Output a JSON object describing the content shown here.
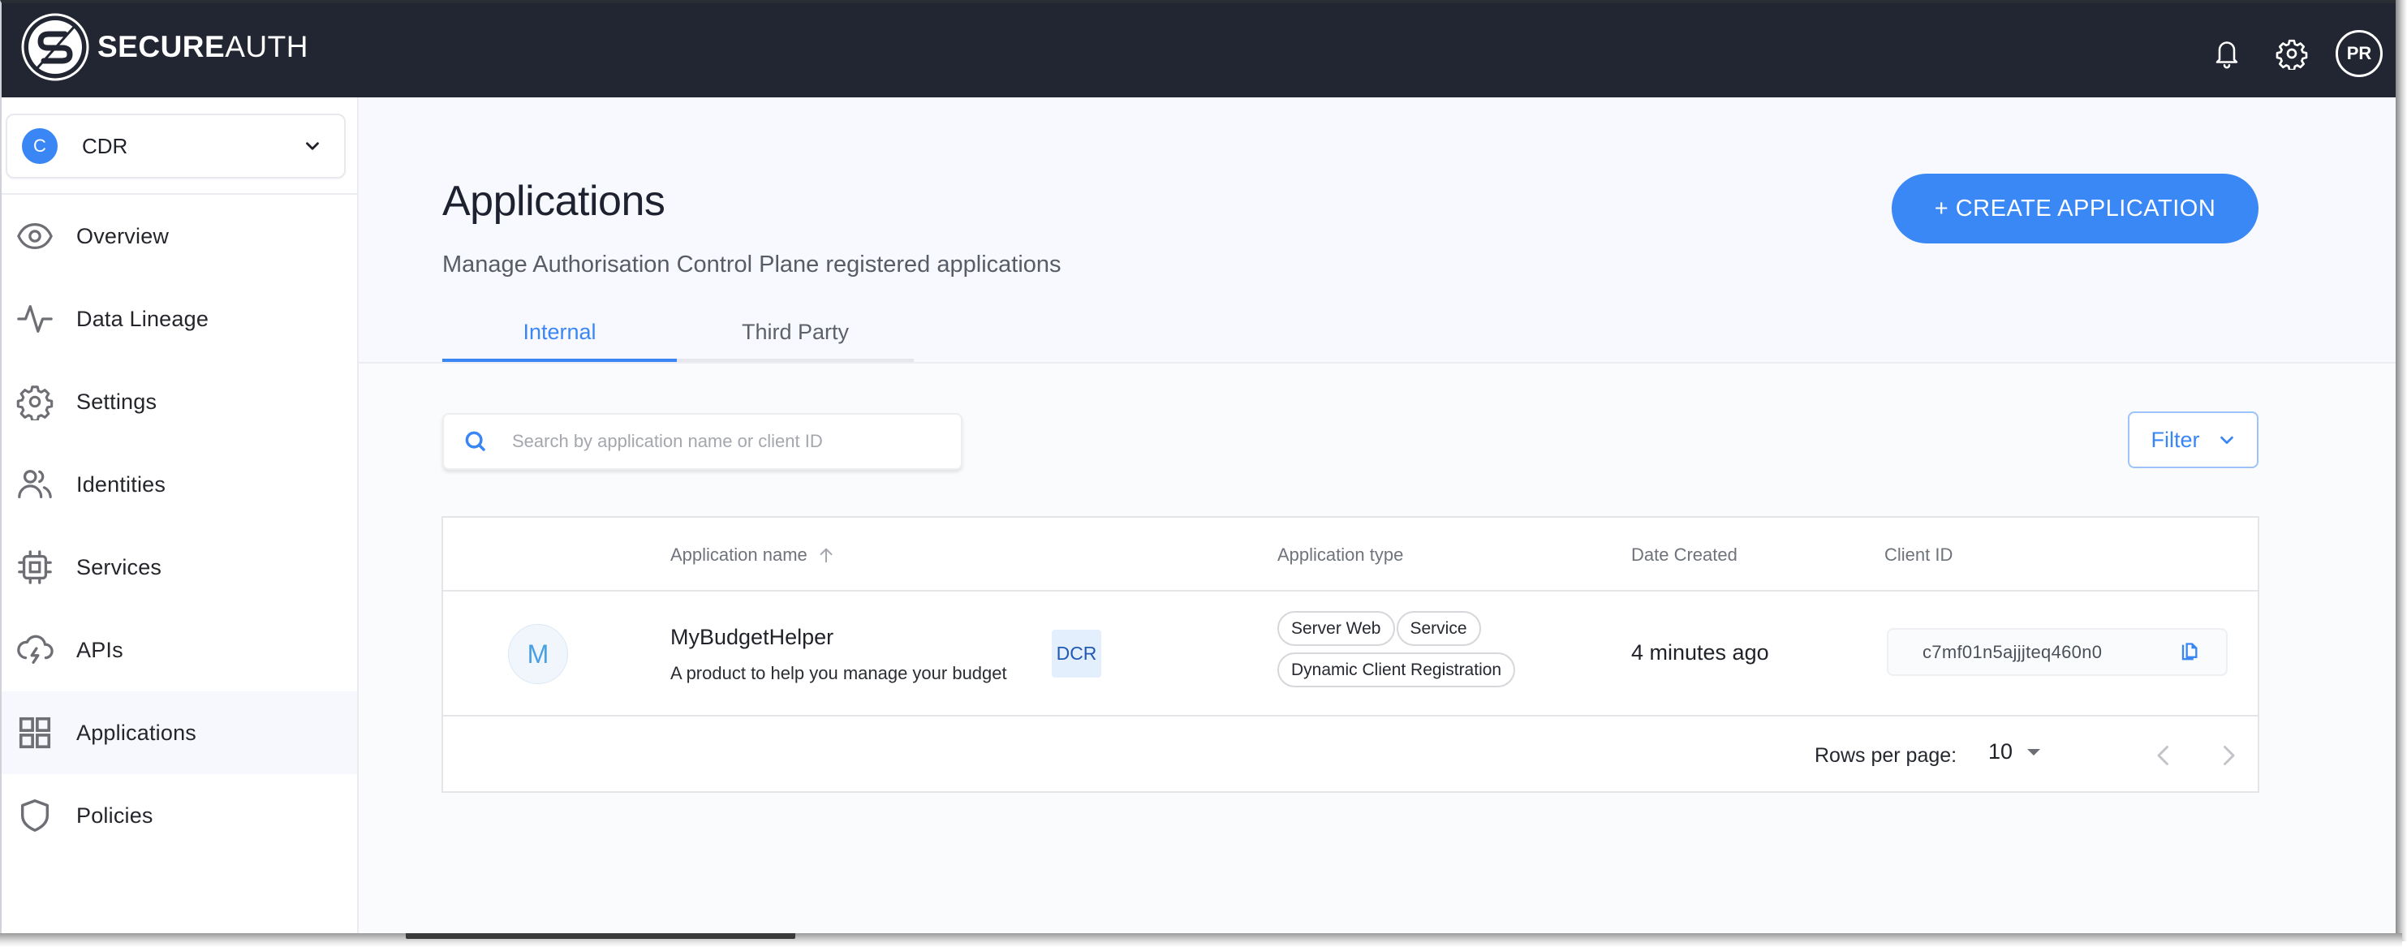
{
  "header": {
    "brand_bold": "SECURE",
    "brand_light": "AUTH",
    "icons": [
      "bell-icon",
      "gear-icon"
    ],
    "user_initials": "PR"
  },
  "sidebar": {
    "tenant": {
      "initial": "C",
      "name": "CDR"
    },
    "items": [
      {
        "label": "Overview",
        "icon": "eye-icon",
        "active": false
      },
      {
        "label": "Data Lineage",
        "icon": "pulse-icon",
        "active": false
      },
      {
        "label": "Settings",
        "icon": "gear-icon",
        "active": false
      },
      {
        "label": "Identities",
        "icon": "users-icon",
        "active": false
      },
      {
        "label": "Services",
        "icon": "chip-icon",
        "active": false
      },
      {
        "label": "APIs",
        "icon": "cloud-lightning-icon",
        "active": false
      },
      {
        "label": "Applications",
        "icon": "grid-icon",
        "active": true
      },
      {
        "label": "Policies",
        "icon": "shield-icon",
        "active": false
      }
    ]
  },
  "main": {
    "title": "Applications",
    "subtitle": "Manage Authorisation Control Plane registered applications",
    "create_button": "+ CREATE APPLICATION",
    "tabs": [
      {
        "label": "Internal",
        "active": true
      },
      {
        "label": "Third Party",
        "active": false
      }
    ],
    "search": {
      "placeholder": "Search by application name or client ID",
      "value": ""
    },
    "filter_label": "Filter",
    "accent_color": "#3b86f5"
  },
  "table": {
    "columns": [
      "",
      "Application name",
      "Application type",
      "Date Created",
      "Client ID"
    ],
    "sorted_column": "Application name",
    "sort_direction": "ascending",
    "rows": [
      {
        "avatar": "M",
        "name": "MyBudgetHelper",
        "description": "A product to help you manage your budget",
        "badge": "DCR",
        "types": [
          "Server Web",
          "Service",
          "Dynamic Client Registration"
        ],
        "date_created": "4 minutes ago",
        "client_id": "c7mf01n5ajjjteq460n0"
      }
    ],
    "pagination": {
      "rows_per_page_label": "Rows per page:",
      "rows_per_page": "10"
    }
  }
}
